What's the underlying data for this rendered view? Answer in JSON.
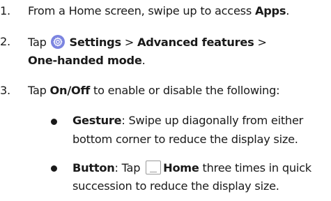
{
  "steps": [
    {
      "number": "1.",
      "pre": "From a Home screen, swipe up to access ",
      "bold": "Apps",
      "post": "."
    },
    {
      "number": "2.",
      "tap": "Tap ",
      "settings": "Settings",
      "sep1": " > ",
      "advanced": "Advanced features",
      "sep2": " >",
      "onehanded": "One-handed mode",
      "end": "."
    },
    {
      "number": "3.",
      "tap": "Tap ",
      "onoff": "On/Off",
      "post": " to enable or disable the following:"
    }
  ],
  "bullets": [
    {
      "title": "Gesture",
      "line1": ": Swipe up diagonally from either",
      "line2": "bottom corner to reduce the display size."
    },
    {
      "title": "Button",
      "tap": ": Tap ",
      "home": "Home",
      "line1": " three times in quick",
      "line2": "succession to reduce the display size."
    }
  ],
  "icons": {
    "settings_icon": "gear-icon",
    "settings_color": "#7b84e0",
    "home_icon": "home-button-icon"
  }
}
